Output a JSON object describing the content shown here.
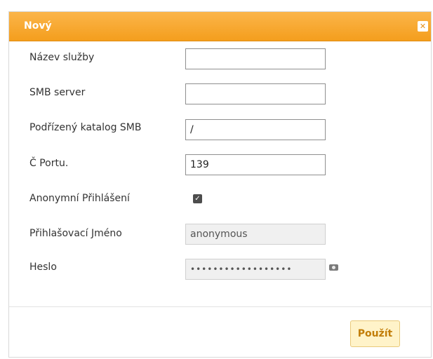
{
  "dialog": {
    "title": "Nový",
    "close_icon": "close-icon",
    "accent_color": "#f49e1d"
  },
  "form": {
    "service_name": {
      "label": "Název služby",
      "value": ""
    },
    "smb_server": {
      "label": "SMB server",
      "value": ""
    },
    "smb_subdir": {
      "label": "Podřízený katalog SMB",
      "value": "/"
    },
    "port": {
      "label": "Č Portu.",
      "value": "139"
    },
    "anonymous_login": {
      "label": "Anonymní Přihlášení",
      "checked": true,
      "check_glyph": "✓"
    },
    "login_name": {
      "label": "Přihlašovací Jméno",
      "value": "anonymous"
    },
    "password": {
      "label": "Heslo",
      "value": "••••••••••••••••••",
      "reveal_icon": "eye-icon"
    }
  },
  "footer": {
    "apply_label": "Použít"
  }
}
